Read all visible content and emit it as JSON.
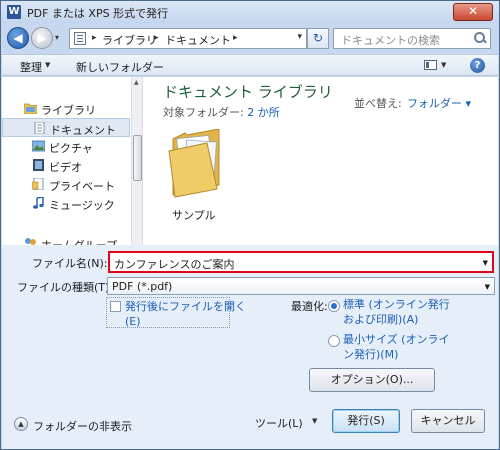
{
  "window": {
    "title": "PDF または XPS 形式で発行",
    "app_icon": "W"
  },
  "nav": {
    "breadcrumb": [
      "ライブラリ",
      "ドキュメント"
    ],
    "search_placeholder": "ドキュメントの検索"
  },
  "toolbar": {
    "organize": "整理",
    "new_folder": "新しいフォルダー"
  },
  "sidebar": {
    "items": [
      {
        "label": "ライブラリ",
        "icon": "library-folder-icon"
      },
      {
        "label": "ドキュメント",
        "icon": "documents-icon",
        "selected": true
      },
      {
        "label": "ピクチャ",
        "icon": "pictures-icon"
      },
      {
        "label": "ビデオ",
        "icon": "videos-icon"
      },
      {
        "label": "プライベート",
        "icon": "private-icon"
      },
      {
        "label": "ミュージック",
        "icon": "music-icon"
      },
      {
        "label": "ホームグループ",
        "icon": "homegroup-icon"
      }
    ]
  },
  "main": {
    "library_title": "ドキュメント ライブラリ",
    "target_label": "対象フォルダー: ",
    "target_link": "2 か所",
    "sort_label": "並べ替え:",
    "sort_value": "フォルダー ▾",
    "folder_name": "サンプル"
  },
  "form": {
    "filename_label": "ファイル名(N):",
    "filename_value": "カンファレンスのご案内",
    "filetype_label": "ファイルの種類(T):",
    "filetype_value": "PDF (*.pdf)",
    "open_after_line1": "発行後にファイルを開く",
    "open_after_line2": "(E)",
    "optimize_label": "最適化:",
    "opt_standard_line1": "標準 (オンライン発行",
    "opt_standard_line2": "および印刷)(A)",
    "opt_min_line1": "最小サイズ (オンライ",
    "opt_min_line2": "ン発行)(M)",
    "options_button": "オプション(O)...",
    "hide_folders": "フォルダーの非表示",
    "tools": "ツール(L)",
    "publish_button": "発行(S)",
    "cancel_button": "キャンセル"
  }
}
